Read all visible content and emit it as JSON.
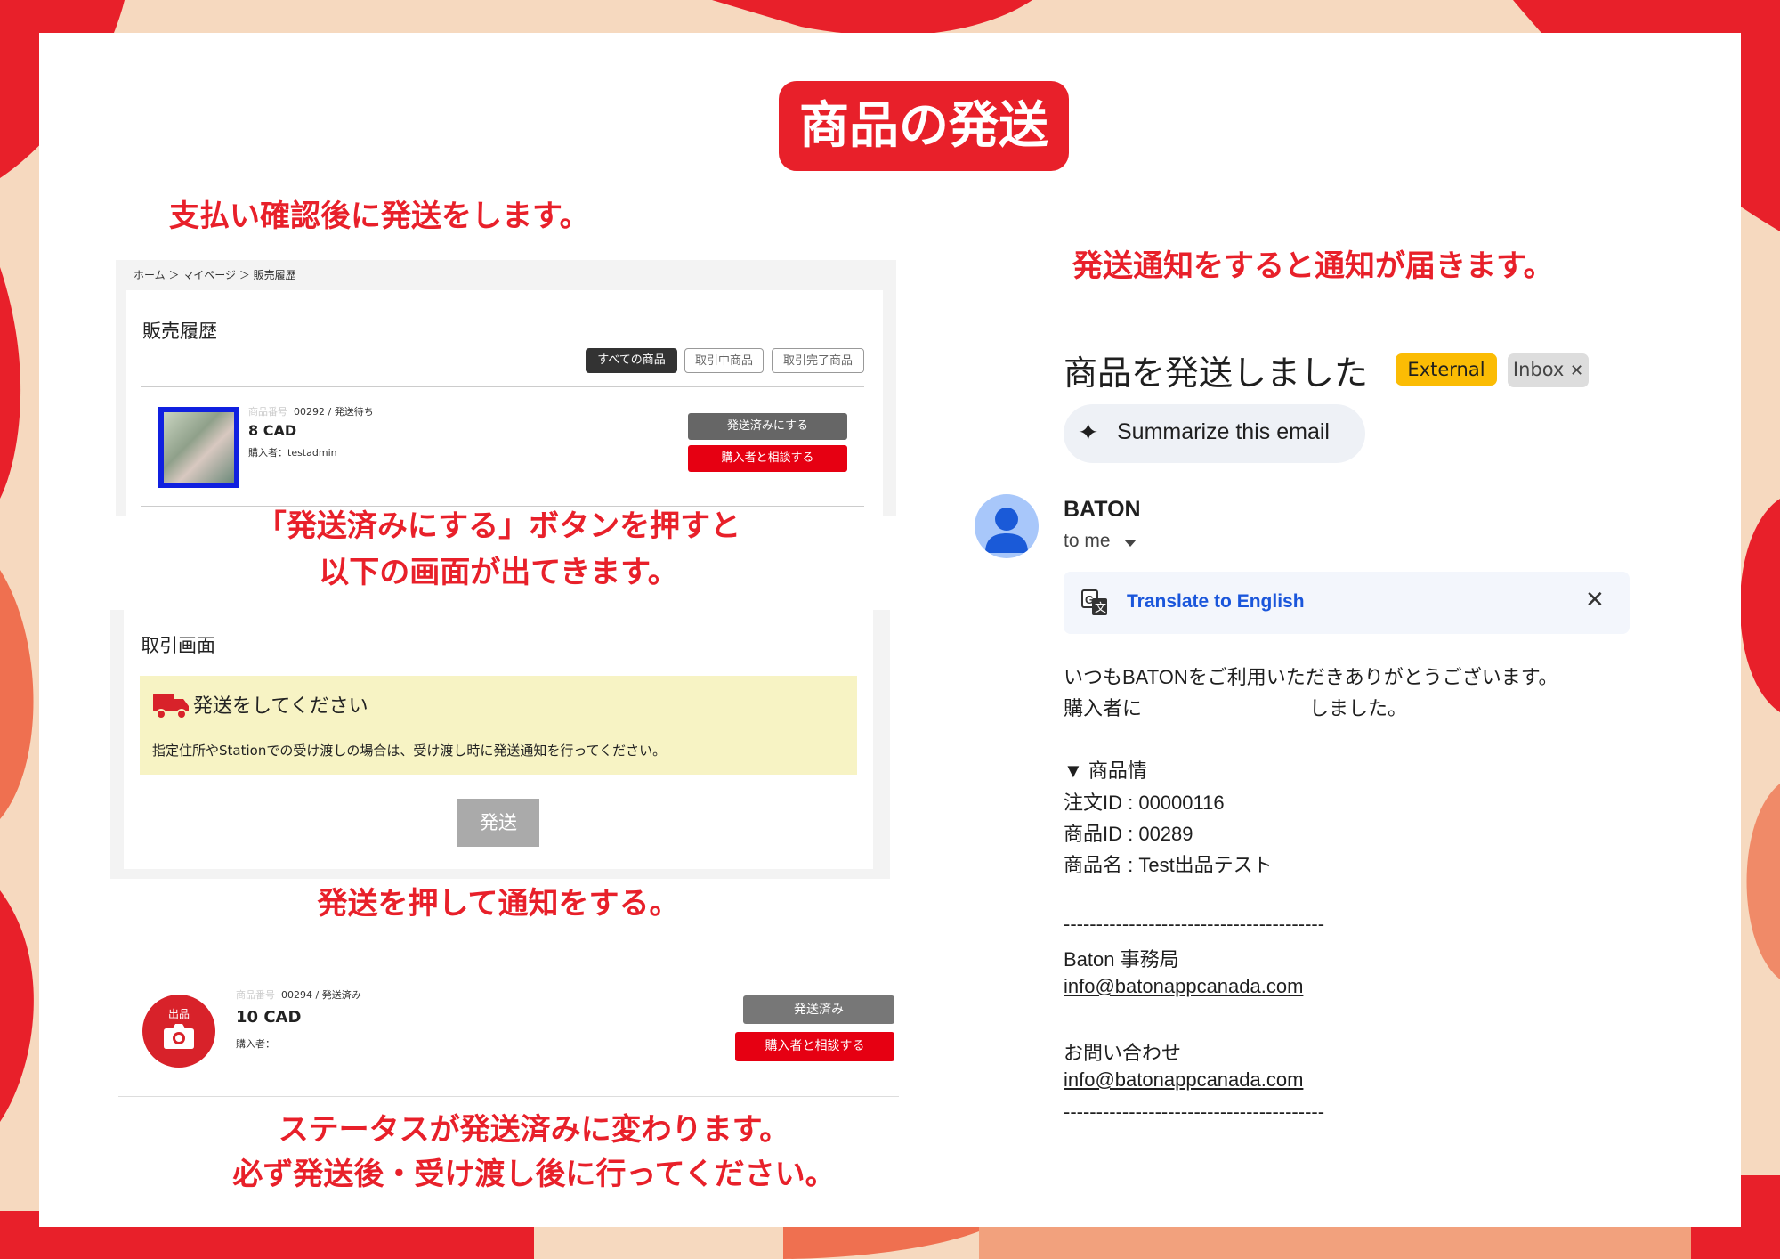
{
  "colors": {
    "accent_red": "#e8202a",
    "background_peach": "#f6d9bf",
    "gmail_link": "#1a56db",
    "external_badge": "#fbbc04"
  },
  "page_title": "商品の発送",
  "captions": {
    "step1": "支払い確認後に発送をします。",
    "step2_line1": "「発送済みにする」ボタンを押すと",
    "step2_line2": "以下の画面が出てきます。",
    "step3": "発送を押して通知をする。",
    "step4_line1": "ステータスが発送済みに変わります。",
    "step4_line2": "必ず発送後・受け渡し後に行ってください。",
    "notify": "発送通知をすると通知が届きます。"
  },
  "sales_history": {
    "breadcrumb": "ホーム ＞ マイページ ＞ 販売履歴",
    "heading": "販売履歴",
    "tabs": [
      "すべての商品",
      "取引中商品",
      "取引完了商品"
    ],
    "item": {
      "number_label": "商品番号",
      "number_status": "00292 / 発送待ち",
      "price": "8 CAD",
      "buyer": "購入者：testadmin",
      "mark_shipped_button": "発送済みにする",
      "consult_button": "購入者と相談する"
    }
  },
  "transaction": {
    "heading": "取引画面",
    "notice_title": "発送をしてください",
    "notice_body": "指定住所やStationでの受け渡しの場合は、受け渡し時に発送通知を行ってください。",
    "send_button": "発送"
  },
  "shipped_item": {
    "icon_label": "出品",
    "number_label": "商品番号",
    "number_status": "00294 / 発送済み",
    "price": "10 CAD",
    "buyer": "購入者：",
    "shipped_button": "発送済み",
    "consult_button": "購入者と相談する"
  },
  "email": {
    "subject": "商品を発送しました",
    "badge_external": "External",
    "badge_inbox": "Inbox",
    "summarize_button": "Summarize this email",
    "sender": "BATON",
    "to_me": "to me",
    "translate": "Translate to English",
    "body": {
      "line1": "いつもBATONをご利用いただきありがとうございます。",
      "line2_start": "購入者に",
      "line2_end": "しました。",
      "section": "▼ 商品情",
      "order_id": "注文ID : 00000116",
      "product_id": "商品ID : 00289",
      "product_name": "商品名 : Test出品テスト",
      "divider": "----------------------------------------",
      "office": "Baton 事務局",
      "email1": "info@batonappcanada.com",
      "contact": "お問い合わせ",
      "email2": "info@batonappcanada.com"
    }
  }
}
